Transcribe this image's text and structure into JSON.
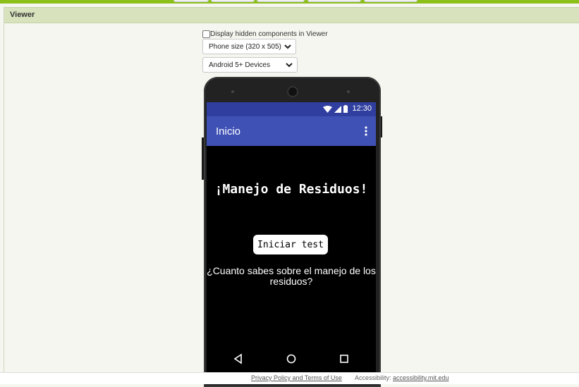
{
  "panel": {
    "title": "Viewer"
  },
  "controls": {
    "hidden_components_label": "Display hidden components in Viewer",
    "phone_size": "Phone size (320 x 505)",
    "device_type": "Android 5+ Devices"
  },
  "phone": {
    "status_time": "12:30",
    "app_title": "Inicio",
    "headline": "¡Manejo de Residuos!",
    "start_button": "Iniciar test",
    "question": "¿Cuanto sabes sobre el manejo de los residuos?"
  },
  "footer": {
    "privacy": "Privacy Policy and Terms of Use",
    "accessibility_label": "Accessibility:",
    "accessibility_link": "accessibility.mit.edu"
  },
  "colors": {
    "topbar": "#8cbf1a",
    "statusbar": "#303f9f",
    "appbar": "#3f51b5"
  }
}
